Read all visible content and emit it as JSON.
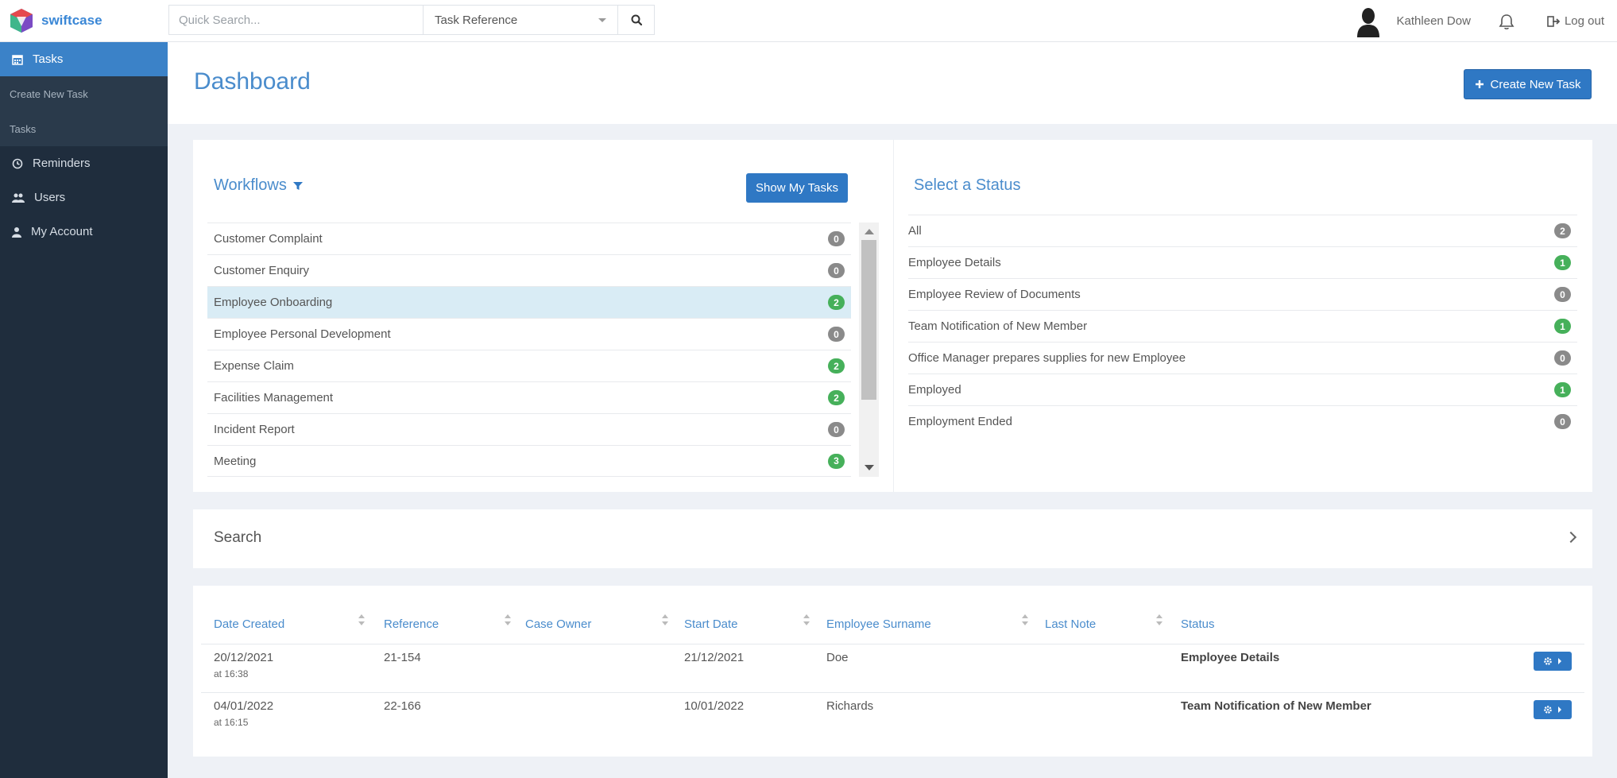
{
  "app": {
    "logo_text": "swiftcase"
  },
  "topbar": {
    "search_placeholder": "Quick Search...",
    "search_type": "Task Reference",
    "user_name": "Kathleen Dow",
    "logout_label": "Log out"
  },
  "sidebar": {
    "items": [
      {
        "label": "Tasks",
        "icon": "calendar-icon"
      },
      {
        "label": "Create New Task"
      },
      {
        "label": "Tasks"
      },
      {
        "label": "Reminders",
        "icon": "clock-icon"
      },
      {
        "label": "Users",
        "icon": "users-icon"
      },
      {
        "label": "My Account",
        "icon": "user-icon"
      }
    ]
  },
  "header": {
    "title": "Dashboard",
    "create_label": "Create New Task"
  },
  "workflows": {
    "title": "Workflows",
    "show_my_tasks": "Show My Tasks",
    "items": [
      {
        "label": "Customer Complaint",
        "count": "0"
      },
      {
        "label": "Customer Enquiry",
        "count": "0"
      },
      {
        "label": "Employee Onboarding",
        "count": "2"
      },
      {
        "label": "Employee Personal Development",
        "count": "0"
      },
      {
        "label": "Expense Claim",
        "count": "2"
      },
      {
        "label": "Facilities Management",
        "count": "2"
      },
      {
        "label": "Incident Report",
        "count": "0"
      },
      {
        "label": "Meeting",
        "count": "3"
      }
    ]
  },
  "statuses": {
    "title": "Select a Status",
    "items": [
      {
        "label": "All",
        "count": "2"
      },
      {
        "label": "Employee Details",
        "count": "1"
      },
      {
        "label": "Employee Review of Documents",
        "count": "0"
      },
      {
        "label": "Team Notification of New Member",
        "count": "1"
      },
      {
        "label": "Office Manager prepares supplies for new Employee",
        "count": "0"
      },
      {
        "label": "Employed",
        "count": "1"
      },
      {
        "label": "Employment Ended",
        "count": "0"
      }
    ]
  },
  "search_panel": {
    "title": "Search"
  },
  "table": {
    "columns": [
      "Date Created",
      "Reference",
      "Case Owner",
      "Start Date",
      "Employee Surname",
      "Last Note",
      "Status"
    ],
    "rows": [
      {
        "date": "20/12/2021",
        "time": "at 16:38",
        "reference": "21-154",
        "owner": "",
        "start": "21/12/2021",
        "surname": "Doe",
        "note": "",
        "status": "Employee Details"
      },
      {
        "date": "04/01/2022",
        "time": "at 16:15",
        "reference": "22-166",
        "owner": "",
        "start": "10/01/2022",
        "surname": "Richards",
        "note": "",
        "status": "Team Notification of New Member"
      }
    ]
  },
  "colors": {
    "accent": "#2f78c4",
    "sidebar": "#1f2d3d",
    "badge_green": "#46b05a",
    "badge_gray": "#8a8a8a"
  }
}
